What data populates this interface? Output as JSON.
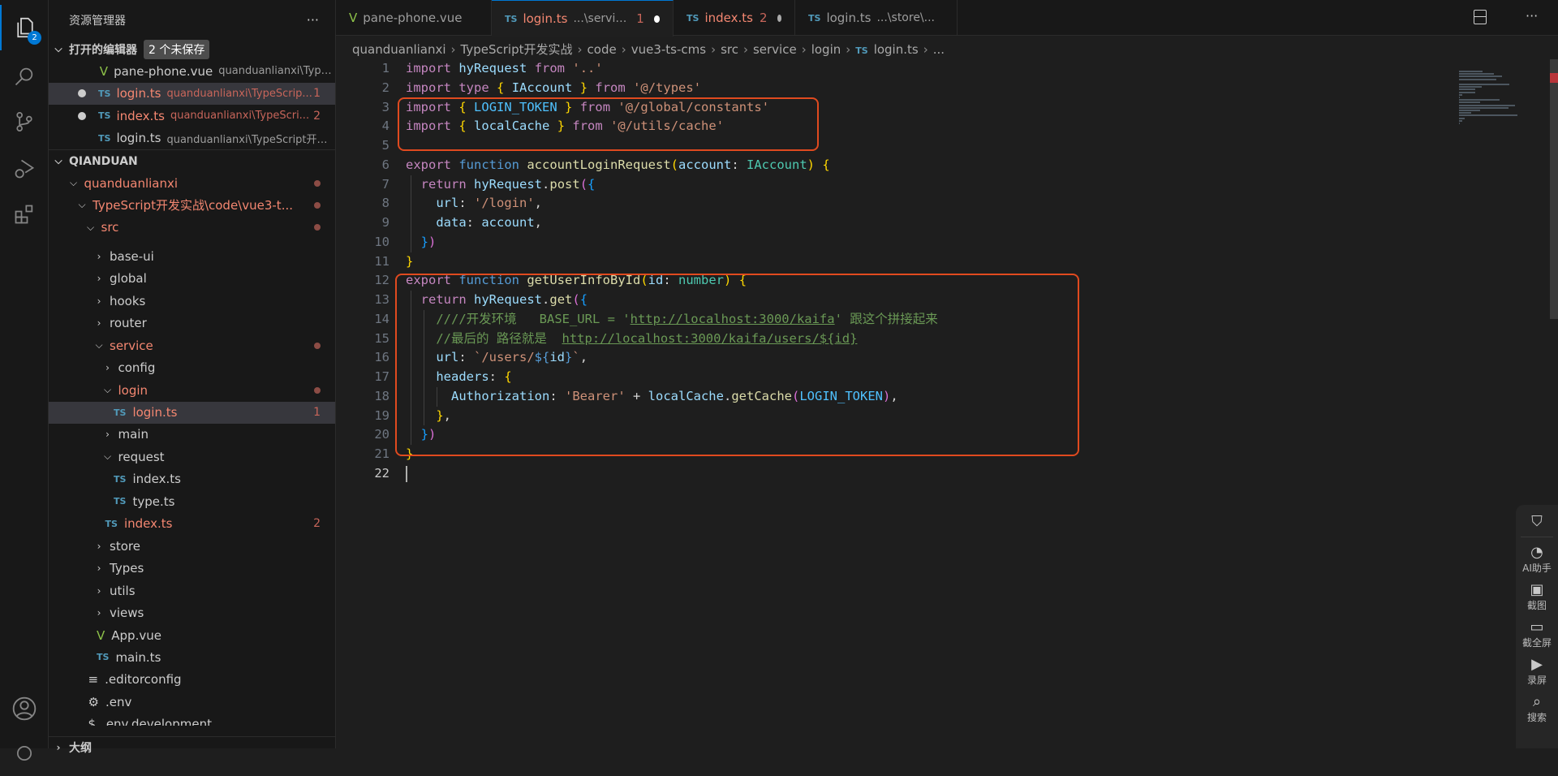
{
  "activity": {
    "explorer_badge": "2",
    "icons": [
      "files-icon",
      "search-icon",
      "source-control-icon",
      "run-debug-icon",
      "extensions-icon",
      "account-icon",
      "settings-icon"
    ]
  },
  "sidebar": {
    "title": "资源管理器",
    "more": "···",
    "open_editors": {
      "label": "打开的编辑器",
      "unsaved": "2 个未保存",
      "items": [
        {
          "icon": "vue",
          "name": "pane-phone.vue",
          "desc": "quanduanlianxi\\Type...",
          "dirty": false,
          "error": false,
          "count": ""
        },
        {
          "icon": "ts",
          "name": "login.ts",
          "desc": "quanduanlianxi\\TypeScrip...",
          "dirty": true,
          "error": true,
          "count": "1",
          "selected": true
        },
        {
          "icon": "ts",
          "name": "index.ts",
          "desc": "quanduanlianxi\\TypeScri...",
          "dirty": true,
          "error": true,
          "count": "2"
        },
        {
          "icon": "ts",
          "name": "login.ts",
          "desc": "quanduanlianxi\\TypeScript开发...",
          "dirty": false,
          "error": false,
          "count": ""
        }
      ]
    },
    "workspace": "QIANDUAN",
    "tree": [
      {
        "d": 1,
        "type": "folder",
        "open": true,
        "name": "quanduanlianxi",
        "error": true,
        "dot": true
      },
      {
        "d": 2,
        "type": "folder",
        "open": true,
        "name": "TypeScript开发实战\\code\\vue3-t...",
        "error": true,
        "dot": true
      },
      {
        "d": 3,
        "type": "folder",
        "open": true,
        "name": "src",
        "error": true,
        "dot": true
      },
      {
        "d": 4,
        "type": "folder",
        "open": false,
        "name": "base-ui"
      },
      {
        "d": 4,
        "type": "folder",
        "open": false,
        "name": "global"
      },
      {
        "d": 4,
        "type": "folder",
        "open": false,
        "name": "hooks"
      },
      {
        "d": 4,
        "type": "folder",
        "open": false,
        "name": "router"
      },
      {
        "d": 4,
        "type": "folder",
        "open": true,
        "name": "service",
        "error": true,
        "dot": true
      },
      {
        "d": 5,
        "type": "folder",
        "open": false,
        "name": "config"
      },
      {
        "d": 5,
        "type": "folder",
        "open": true,
        "name": "login",
        "error": true,
        "dot": true
      },
      {
        "d": 6,
        "type": "ts",
        "name": "login.ts",
        "error": true,
        "count": "1",
        "selected": true
      },
      {
        "d": 5,
        "type": "folder",
        "open": false,
        "name": "main"
      },
      {
        "d": 5,
        "type": "folder",
        "open": true,
        "name": "request"
      },
      {
        "d": 6,
        "type": "ts",
        "name": "index.ts"
      },
      {
        "d": 6,
        "type": "ts",
        "name": "type.ts"
      },
      {
        "d": 5,
        "type": "ts",
        "name": "index.ts",
        "error": true,
        "count": "2"
      },
      {
        "d": 4,
        "type": "folder",
        "open": false,
        "name": "store"
      },
      {
        "d": 4,
        "type": "folder",
        "open": false,
        "name": "Types"
      },
      {
        "d": 4,
        "type": "folder",
        "open": false,
        "name": "utils"
      },
      {
        "d": 4,
        "type": "folder",
        "open": false,
        "name": "views"
      },
      {
        "d": 4,
        "type": "vue",
        "name": "App.vue"
      },
      {
        "d": 4,
        "type": "ts",
        "name": "main.ts"
      },
      {
        "d": 3,
        "type": "config",
        "name": ".editorconfig"
      },
      {
        "d": 3,
        "type": "env",
        "name": ".env"
      },
      {
        "d": 3,
        "type": "dollar",
        "name": ".env.development"
      }
    ],
    "outline": "大纲"
  },
  "tabs": [
    {
      "icon": "vue",
      "name": "pane-phone.vue",
      "desc": "",
      "count": "",
      "dirty": false
    },
    {
      "icon": "ts",
      "name": "login.ts",
      "desc": "...\\service\\...",
      "count": "1",
      "dirty": true,
      "active": true,
      "error": true
    },
    {
      "icon": "ts",
      "name": "index.ts",
      "desc": "",
      "count": "2",
      "dirty": true,
      "error": true
    },
    {
      "icon": "ts",
      "name": "login.ts",
      "desc": "...\\store\\...",
      "count": "",
      "dirty": false
    }
  ],
  "breadcrumb": [
    "quanduanlianxi",
    "TypeScript开发实战",
    "code",
    "vue3-ts-cms",
    "src",
    "service",
    "login",
    "login.ts",
    "..."
  ],
  "code": [
    [
      [
        "import",
        "k"
      ],
      [
        " ",
        "p"
      ],
      [
        "hyRequest",
        "v"
      ],
      [
        " ",
        "p"
      ],
      [
        "from",
        "k"
      ],
      [
        " ",
        "p"
      ],
      [
        "'..'",
        "s"
      ]
    ],
    [
      [
        "import",
        "k"
      ],
      [
        " ",
        "p"
      ],
      [
        "type",
        "k"
      ],
      [
        " ",
        "p"
      ],
      [
        "{",
        "c1"
      ],
      [
        " ",
        "p"
      ],
      [
        "IAccount",
        "v"
      ],
      [
        " ",
        "p"
      ],
      [
        "}",
        "c1"
      ],
      [
        " ",
        "p"
      ],
      [
        "from",
        "k"
      ],
      [
        " ",
        "p"
      ],
      [
        "'@/types'",
        "s"
      ]
    ],
    [
      [
        "import",
        "k"
      ],
      [
        " ",
        "p"
      ],
      [
        "{",
        "c1"
      ],
      [
        " ",
        "p"
      ],
      [
        "LOGIN_TOKEN",
        "cn"
      ],
      [
        " ",
        "p"
      ],
      [
        "}",
        "c1"
      ],
      [
        " ",
        "p"
      ],
      [
        "from",
        "k"
      ],
      [
        " ",
        "p"
      ],
      [
        "'@/global/constants'",
        "s"
      ]
    ],
    [
      [
        "import",
        "k"
      ],
      [
        " ",
        "p"
      ],
      [
        "{",
        "c1"
      ],
      [
        " ",
        "p"
      ],
      [
        "localCache",
        "v"
      ],
      [
        " ",
        "p"
      ],
      [
        "}",
        "c1"
      ],
      [
        " ",
        "p"
      ],
      [
        "from",
        "k"
      ],
      [
        " ",
        "p"
      ],
      [
        "'@/utils/cache'",
        "s"
      ]
    ],
    [],
    [
      [
        "export",
        "k"
      ],
      [
        " ",
        "p"
      ],
      [
        "function",
        "b"
      ],
      [
        " ",
        "p"
      ],
      [
        "accountLoginRequest",
        "f"
      ],
      [
        "(",
        "c1"
      ],
      [
        "account",
        "v"
      ],
      [
        ": ",
        "p"
      ],
      [
        "IAccount",
        "t"
      ],
      [
        ")",
        "c1"
      ],
      [
        " ",
        "p"
      ],
      [
        "{",
        "c1"
      ]
    ],
    [
      [
        "  ",
        "p"
      ],
      [
        "return",
        "k"
      ],
      [
        " ",
        "p"
      ],
      [
        "hyRequest",
        "v"
      ],
      [
        ".",
        "p"
      ],
      [
        "post",
        "f"
      ],
      [
        "(",
        "c2"
      ],
      [
        "{",
        "c3"
      ]
    ],
    [
      [
        "    ",
        "p"
      ],
      [
        "url",
        "v"
      ],
      [
        ": ",
        "p"
      ],
      [
        "'/login'",
        "s"
      ],
      [
        ",",
        "p"
      ]
    ],
    [
      [
        "    ",
        "p"
      ],
      [
        "data",
        "v"
      ],
      [
        ": ",
        "p"
      ],
      [
        "account",
        "v"
      ],
      [
        ",",
        "p"
      ]
    ],
    [
      [
        "  ",
        "p"
      ],
      [
        "}",
        "c3"
      ],
      [
        ")",
        "c2"
      ]
    ],
    [
      [
        "}",
        "c1"
      ]
    ],
    [
      [
        "export",
        "k"
      ],
      [
        " ",
        "p"
      ],
      [
        "function",
        "b"
      ],
      [
        " ",
        "p"
      ],
      [
        "getUserInfoById",
        "f"
      ],
      [
        "(",
        "c1"
      ],
      [
        "id",
        "v"
      ],
      [
        ": ",
        "p"
      ],
      [
        "number",
        "t"
      ],
      [
        ")",
        "c1"
      ],
      [
        " ",
        "p"
      ],
      [
        "{",
        "c1"
      ]
    ],
    [
      [
        "  ",
        "p"
      ],
      [
        "return",
        "k"
      ],
      [
        " ",
        "p"
      ],
      [
        "hyRequest",
        "v"
      ],
      [
        ".",
        "p"
      ],
      [
        "get",
        "f"
      ],
      [
        "(",
        "c2"
      ],
      [
        "{",
        "c3"
      ]
    ],
    [
      [
        "    ",
        "p"
      ],
      [
        "////开发环境   BASE_URL = '",
        "c"
      ],
      [
        "http://localhost:3000/kaifa",
        "u"
      ],
      [
        "' 跟这个拼接起来",
        "c"
      ]
    ],
    [
      [
        "    ",
        "p"
      ],
      [
        "//最后的 路径就是  ",
        "c"
      ],
      [
        "http://localhost:3000/kaifa/users/${id}",
        "u"
      ]
    ],
    [
      [
        "    ",
        "p"
      ],
      [
        "url",
        "v"
      ],
      [
        ": ",
        "p"
      ],
      [
        "`/users/",
        "s"
      ],
      [
        "${",
        "b"
      ],
      [
        "id",
        "v"
      ],
      [
        "}",
        "b"
      ],
      [
        "`",
        "s"
      ],
      [
        ",",
        "p"
      ]
    ],
    [
      [
        "    ",
        "p"
      ],
      [
        "headers",
        "v"
      ],
      [
        ": ",
        "p"
      ],
      [
        "{",
        "c1"
      ]
    ],
    [
      [
        "      ",
        "p"
      ],
      [
        "Authorization",
        "v"
      ],
      [
        ": ",
        "p"
      ],
      [
        "'Bearer'",
        "s"
      ],
      [
        " + ",
        "p"
      ],
      [
        "localCache",
        "v"
      ],
      [
        ".",
        "p"
      ],
      [
        "getCache",
        "f"
      ],
      [
        "(",
        "c2"
      ],
      [
        "LOGIN_TOKEN",
        "cn"
      ],
      [
        ")",
        "c2"
      ],
      [
        ",",
        "p"
      ]
    ],
    [
      [
        "    ",
        "p"
      ],
      [
        "}",
        "c1"
      ],
      [
        ",",
        "p"
      ]
    ],
    [
      [
        "  ",
        "p"
      ],
      [
        "}",
        "c3"
      ],
      [
        ")",
        "c2"
      ]
    ],
    [
      [
        "}",
        "c1"
      ]
    ],
    []
  ],
  "float_toolbar": [
    {
      "icon": "shield-icon",
      "label": ""
    },
    {
      "icon": "ai-assistant-icon",
      "label": "AI助手"
    },
    {
      "icon": "camera-icon",
      "label": "截图"
    },
    {
      "icon": "fullscreen-capture-icon",
      "label": "截全屏"
    },
    {
      "icon": "record-icon",
      "label": "录屏"
    },
    {
      "icon": "search-folder-icon",
      "label": "搜索"
    }
  ],
  "colors": {
    "accent": "#0078d4",
    "error": "#f48771",
    "annotation_box": "#e04a1f"
  }
}
